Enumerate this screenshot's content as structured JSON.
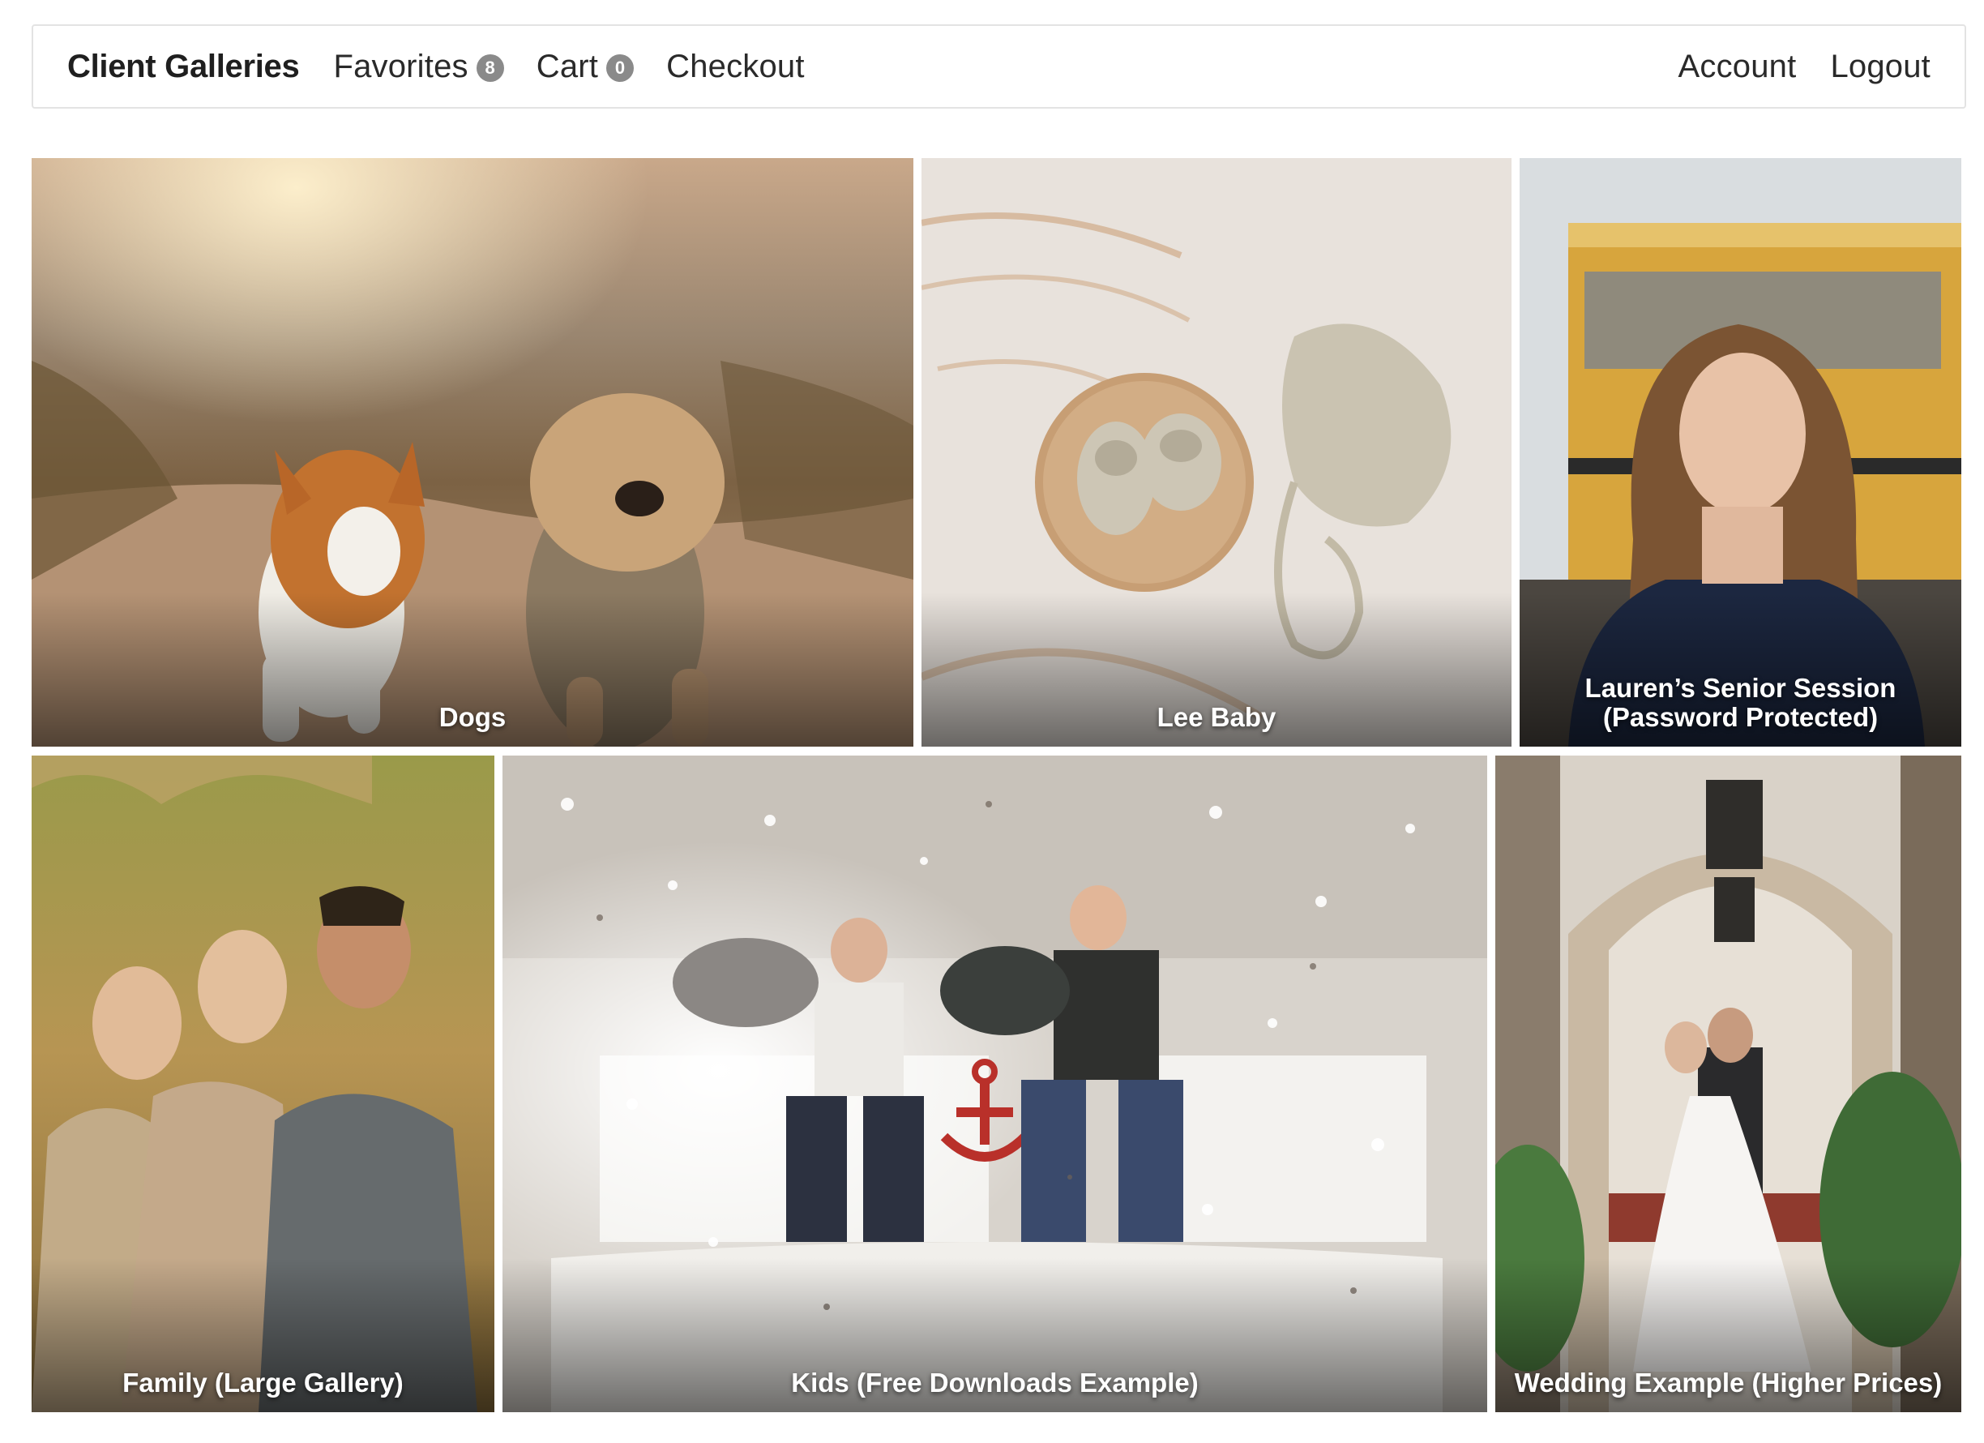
{
  "navbar": {
    "brand": "Client Galleries",
    "favorites": {
      "label": "Favorites",
      "count": "8"
    },
    "cart": {
      "label": "Cart",
      "count": "0"
    },
    "checkout": "Checkout",
    "account": "Account",
    "logout": "Logout"
  },
  "galleries": [
    {
      "title": "Dogs"
    },
    {
      "title": "Lee Baby"
    },
    {
      "title": "Lauren’s Senior Session (Password Protected)"
    },
    {
      "title": "Family (Large Gallery)"
    },
    {
      "title": "Kids (Free Downloads Example)"
    },
    {
      "title": "Wedding Example (Higher Prices)"
    }
  ],
  "colors": {
    "badge": "#8a8a8a",
    "border": "#e3e3e3",
    "text": "#222222"
  }
}
